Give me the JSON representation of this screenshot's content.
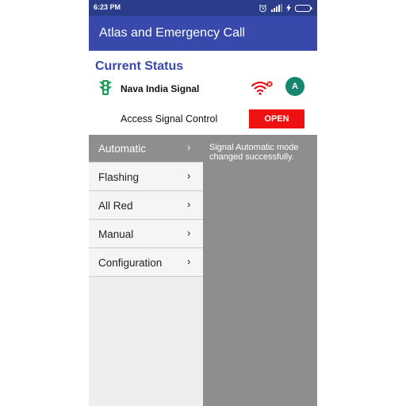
{
  "status_bar": {
    "time": "6:23 PM",
    "icons": [
      "alarm-icon",
      "signal-icon",
      "charging-icon",
      "battery-icon"
    ]
  },
  "app_bar": {
    "title": "Atlas and Emergency Call"
  },
  "current_status": {
    "heading": "Current Status",
    "signal_name": "Nava India Signal",
    "wifi_state": "disconnected",
    "avatar_letter": "A"
  },
  "access": {
    "label": "Access Signal Control",
    "button_label": "OPEN"
  },
  "menu": {
    "items": [
      {
        "label": "Automatic",
        "chevron": "›",
        "active": true
      },
      {
        "label": "Flashing",
        "chevron": "›",
        "active": false
      },
      {
        "label": "All Red",
        "chevron": "›",
        "active": false
      },
      {
        "label": "Manual",
        "chevron": "›",
        "active": false
      },
      {
        "label": "Configuration",
        "chevron": "›",
        "active": false
      }
    ]
  },
  "detail": {
    "message": "Signal Automatic mode changed successfully."
  },
  "colors": {
    "primary": "#3949ab",
    "status_bar": "#2a3c8a",
    "open_button": "#ee1111",
    "avatar": "#16876f",
    "active_menu": "#8e8e8e",
    "traffic_light": "#1b9e57"
  }
}
